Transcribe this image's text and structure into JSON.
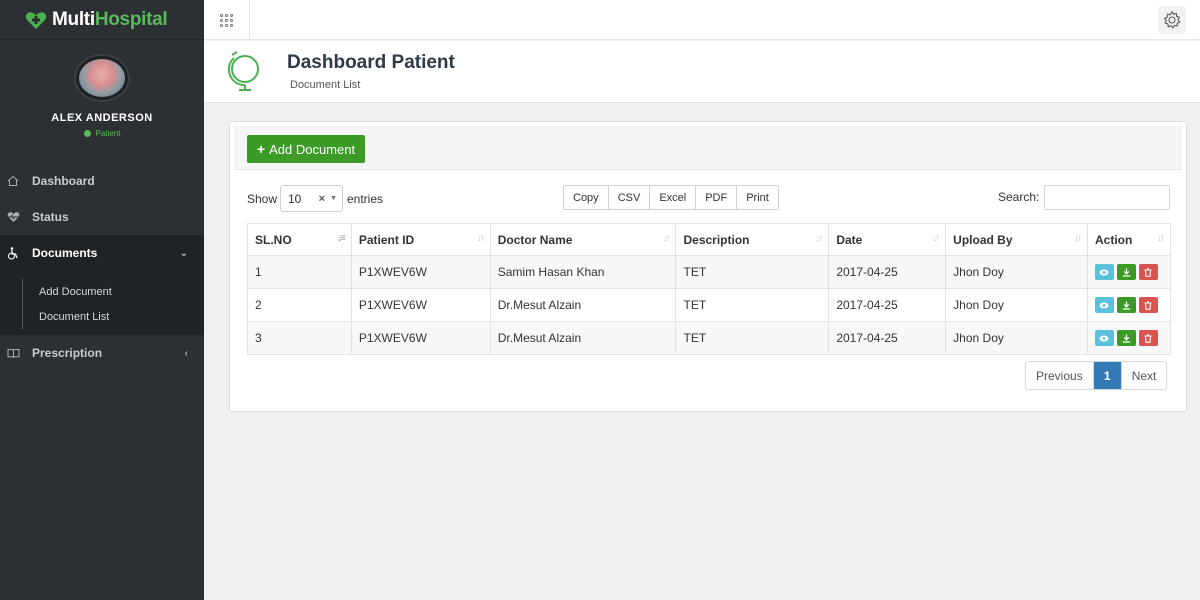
{
  "brand": {
    "prefix": "Multi",
    "name": "Hospital"
  },
  "profile": {
    "name": "ALEX ANDERSON",
    "role": "Patient"
  },
  "sidebar": {
    "items": [
      {
        "label": "Dashboard",
        "icon": "home-icon"
      },
      {
        "label": "Status",
        "icon": "heartbeat-icon"
      },
      {
        "label": "Documents",
        "icon": "wheelchair-icon",
        "active": true,
        "expanded": true,
        "children": [
          {
            "label": "Add Document"
          },
          {
            "label": "Document List"
          }
        ]
      },
      {
        "label": "Prescription",
        "icon": "book-icon"
      }
    ]
  },
  "header": {
    "title": "Dashboard Patient",
    "subtitle": "Document List"
  },
  "toolbar": {
    "add_label": "Add Document"
  },
  "table_controls": {
    "show_label": "Show",
    "entries_value": "10",
    "entries_label": "entries",
    "export_buttons": [
      "Copy",
      "CSV",
      "Excel",
      "PDF",
      "Print"
    ],
    "search_label": "Search:",
    "search_value": ""
  },
  "table": {
    "columns": [
      "SL.NO",
      "Patient ID",
      "Doctor Name",
      "Description",
      "Date",
      "Upload By",
      "Action"
    ],
    "rows": [
      [
        "1",
        "P1XWEV6W",
        "Samim Hasan Khan",
        "TET",
        "2017-04-25",
        "Jhon Doy"
      ],
      [
        "2",
        "P1XWEV6W",
        "Dr.Mesut Alzain",
        "TET",
        "2017-04-25",
        "Jhon Doy"
      ],
      [
        "3",
        "P1XWEV6W",
        "Dr.Mesut Alzain",
        "TET",
        "2017-04-25",
        "Jhon Doy"
      ]
    ]
  },
  "pagination": {
    "previous": "Previous",
    "current": "1",
    "next": "Next"
  },
  "colors": {
    "accent_green": "#3c9b27",
    "sidebar_bg": "#2c3034",
    "view_btn": "#5bc0de",
    "delete_btn": "#d9534f",
    "page_active": "#337ab7"
  }
}
